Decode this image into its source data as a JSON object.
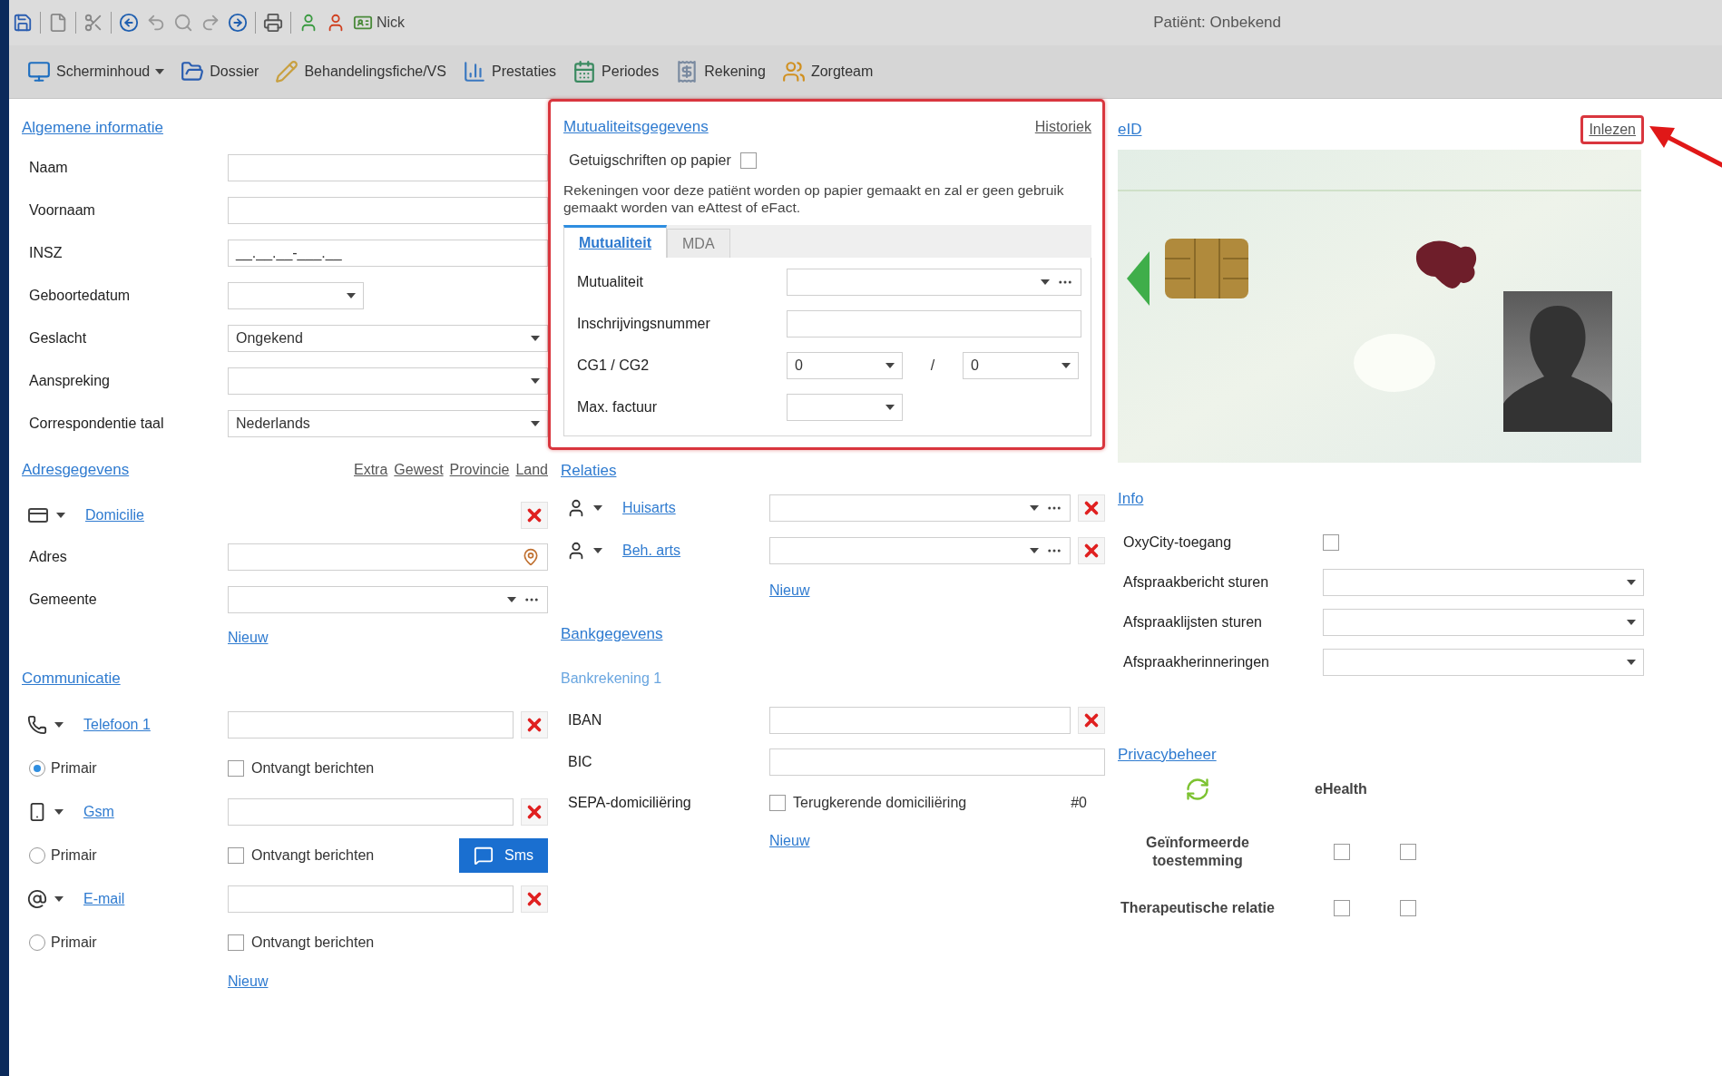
{
  "toolbar": {
    "user_label": "Nick",
    "patient_label": "Patiënt: Onbekend"
  },
  "menu_bar": [
    {
      "kind": "screen",
      "label": "Scherminhoud",
      "has_menu": true
    },
    {
      "kind": "dossier",
      "label": "Dossier",
      "has_menu": false
    },
    {
      "kind": "sheet",
      "label": "Behandelingsfiche/VS",
      "has_menu": false
    },
    {
      "kind": "services",
      "label": "Prestaties",
      "has_menu": false
    },
    {
      "kind": "periods",
      "label": "Periodes",
      "has_menu": false
    },
    {
      "kind": "invoice",
      "label": "Rekening",
      "has_menu": false
    },
    {
      "kind": "team",
      "label": "Zorgteam",
      "has_menu": false
    }
  ],
  "general": {
    "title": "Algemene informatie",
    "fields": [
      {
        "label": "Naam",
        "kind": "text"
      },
      {
        "label": "Voornaam",
        "kind": "text"
      },
      {
        "label": "INSZ",
        "kind": "text",
        "value": "__.__.__-___.__"
      },
      {
        "label": "Geboortedatum",
        "kind": "date"
      },
      {
        "label": "Geslacht",
        "kind": "dropdown",
        "value": "Ongekend"
      },
      {
        "label": "Aanspreking",
        "kind": "dropdown"
      },
      {
        "label": "Correspondentie taal",
        "kind": "dropdown",
        "value": "Nederlands"
      }
    ]
  },
  "address": {
    "title": "Adresgegevens",
    "links": [
      "Extra",
      "Gewest",
      "Provincie",
      "Land"
    ],
    "type_link": "Domicilie",
    "fields": [
      {
        "label": "Adres",
        "kind": "address"
      },
      {
        "label": "Gemeente",
        "kind": "combo"
      }
    ],
    "new_link": "Nieuw"
  },
  "communication": {
    "title": "Communicatie",
    "entries": [
      {
        "kind": "phone",
        "link": "Telefoon 1",
        "primary_label": "Primair",
        "selected": true,
        "messages_label": "Ontvangt berichten",
        "checked": false
      },
      {
        "kind": "mobile",
        "link": "Gsm",
        "primary_label": "Primair",
        "selected": false,
        "messages_label": "Ontvangt berichten",
        "checked": false,
        "sms_button": "Sms"
      },
      {
        "kind": "email",
        "link": "E-mail",
        "primary_label": "Primair",
        "selected": false,
        "messages_label": "Ontvangt berichten",
        "checked": false
      }
    ],
    "new_link": "Nieuw"
  },
  "insurance": {
    "title": "Mutualiteitsgegevens",
    "highlighted": true,
    "history_link": "Historiek",
    "paper_label": "Getuigschriften op papier",
    "paper_checked": false,
    "note": "Rekeningen voor deze patiënt worden op papier gemaakt en zal er geen gebruik gemaakt worden van eAttest of eFact.",
    "tabs": [
      {
        "label": "Mutualiteit",
        "selected": true
      },
      {
        "label": "MDA",
        "selected": false
      }
    ],
    "fields": [
      {
        "label": "Mutualiteit",
        "kind": "combo"
      },
      {
        "label": "Inschrijvingsnummer",
        "kind": "text"
      },
      {
        "label": "CG1 / CG2",
        "kind": "pair",
        "values": [
          "0",
          "0"
        ],
        "separator": "/"
      },
      {
        "label": "Max. factuur",
        "kind": "short_dropdown"
      }
    ]
  },
  "relations": {
    "title": "Relaties",
    "items": [
      {
        "link": "Huisarts"
      },
      {
        "link": "Beh. arts"
      }
    ],
    "new_link": "Nieuw"
  },
  "bank": {
    "title": "Bankgegevens",
    "account": "Bankrekening 1",
    "iban_label": "IBAN",
    "bic_label": "BIC",
    "sepa_label": "SEPA-domiciliëring",
    "recurring_label": "Terugkerende domiciliëring",
    "recurring_checked": false,
    "count": "#0",
    "new_link": "Nieuw"
  },
  "eid": {
    "title": "eID",
    "read_link": "Inlezen",
    "highlighted": true
  },
  "info": {
    "title": "Info",
    "rows": [
      {
        "label": "OxyCity-toegang",
        "kind": "checkbox",
        "checked": false
      },
      {
        "label": "Afspraakbericht sturen",
        "kind": "dropdown"
      },
      {
        "label": "Afspraaklijsten sturen",
        "kind": "dropdown"
      },
      {
        "label": "Afspraakherinneringen",
        "kind": "dropdown"
      }
    ]
  },
  "privacy": {
    "title": "Privacybeheer",
    "header": "eHealth",
    "rows": [
      {
        "label": "Geïnformeerde toestemming",
        "checks": [
          false,
          false
        ]
      },
      {
        "label": "Therapeutische relatie",
        "checks": [
          false,
          false
        ]
      }
    ]
  }
}
